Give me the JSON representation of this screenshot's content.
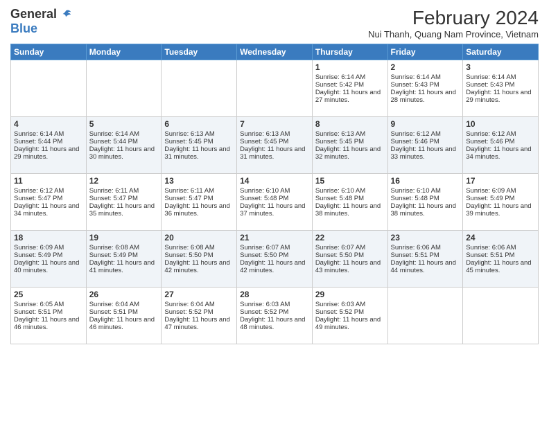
{
  "logo": {
    "general": "General",
    "blue": "Blue"
  },
  "title": {
    "month_year": "February 2024",
    "location": "Nui Thanh, Quang Nam Province, Vietnam"
  },
  "weekdays": [
    "Sunday",
    "Monday",
    "Tuesday",
    "Wednesday",
    "Thursday",
    "Friday",
    "Saturday"
  ],
  "weeks": [
    [
      {
        "day": "",
        "info": ""
      },
      {
        "day": "",
        "info": ""
      },
      {
        "day": "",
        "info": ""
      },
      {
        "day": "",
        "info": ""
      },
      {
        "day": "1",
        "info": "Sunrise: 6:14 AM\nSunset: 5:42 PM\nDaylight: 11 hours and 27 minutes."
      },
      {
        "day": "2",
        "info": "Sunrise: 6:14 AM\nSunset: 5:43 PM\nDaylight: 11 hours and 28 minutes."
      },
      {
        "day": "3",
        "info": "Sunrise: 6:14 AM\nSunset: 5:43 PM\nDaylight: 11 hours and 29 minutes."
      }
    ],
    [
      {
        "day": "4",
        "info": "Sunrise: 6:14 AM\nSunset: 5:44 PM\nDaylight: 11 hours and 29 minutes."
      },
      {
        "day": "5",
        "info": "Sunrise: 6:14 AM\nSunset: 5:44 PM\nDaylight: 11 hours and 30 minutes."
      },
      {
        "day": "6",
        "info": "Sunrise: 6:13 AM\nSunset: 5:45 PM\nDaylight: 11 hours and 31 minutes."
      },
      {
        "day": "7",
        "info": "Sunrise: 6:13 AM\nSunset: 5:45 PM\nDaylight: 11 hours and 31 minutes."
      },
      {
        "day": "8",
        "info": "Sunrise: 6:13 AM\nSunset: 5:45 PM\nDaylight: 11 hours and 32 minutes."
      },
      {
        "day": "9",
        "info": "Sunrise: 6:12 AM\nSunset: 5:46 PM\nDaylight: 11 hours and 33 minutes."
      },
      {
        "day": "10",
        "info": "Sunrise: 6:12 AM\nSunset: 5:46 PM\nDaylight: 11 hours and 34 minutes."
      }
    ],
    [
      {
        "day": "11",
        "info": "Sunrise: 6:12 AM\nSunset: 5:47 PM\nDaylight: 11 hours and 34 minutes."
      },
      {
        "day": "12",
        "info": "Sunrise: 6:11 AM\nSunset: 5:47 PM\nDaylight: 11 hours and 35 minutes."
      },
      {
        "day": "13",
        "info": "Sunrise: 6:11 AM\nSunset: 5:47 PM\nDaylight: 11 hours and 36 minutes."
      },
      {
        "day": "14",
        "info": "Sunrise: 6:10 AM\nSunset: 5:48 PM\nDaylight: 11 hours and 37 minutes."
      },
      {
        "day": "15",
        "info": "Sunrise: 6:10 AM\nSunset: 5:48 PM\nDaylight: 11 hours and 38 minutes."
      },
      {
        "day": "16",
        "info": "Sunrise: 6:10 AM\nSunset: 5:48 PM\nDaylight: 11 hours and 38 minutes."
      },
      {
        "day": "17",
        "info": "Sunrise: 6:09 AM\nSunset: 5:49 PM\nDaylight: 11 hours and 39 minutes."
      }
    ],
    [
      {
        "day": "18",
        "info": "Sunrise: 6:09 AM\nSunset: 5:49 PM\nDaylight: 11 hours and 40 minutes."
      },
      {
        "day": "19",
        "info": "Sunrise: 6:08 AM\nSunset: 5:49 PM\nDaylight: 11 hours and 41 minutes."
      },
      {
        "day": "20",
        "info": "Sunrise: 6:08 AM\nSunset: 5:50 PM\nDaylight: 11 hours and 42 minutes."
      },
      {
        "day": "21",
        "info": "Sunrise: 6:07 AM\nSunset: 5:50 PM\nDaylight: 11 hours and 42 minutes."
      },
      {
        "day": "22",
        "info": "Sunrise: 6:07 AM\nSunset: 5:50 PM\nDaylight: 11 hours and 43 minutes."
      },
      {
        "day": "23",
        "info": "Sunrise: 6:06 AM\nSunset: 5:51 PM\nDaylight: 11 hours and 44 minutes."
      },
      {
        "day": "24",
        "info": "Sunrise: 6:06 AM\nSunset: 5:51 PM\nDaylight: 11 hours and 45 minutes."
      }
    ],
    [
      {
        "day": "25",
        "info": "Sunrise: 6:05 AM\nSunset: 5:51 PM\nDaylight: 11 hours and 46 minutes."
      },
      {
        "day": "26",
        "info": "Sunrise: 6:04 AM\nSunset: 5:51 PM\nDaylight: 11 hours and 46 minutes."
      },
      {
        "day": "27",
        "info": "Sunrise: 6:04 AM\nSunset: 5:52 PM\nDaylight: 11 hours and 47 minutes."
      },
      {
        "day": "28",
        "info": "Sunrise: 6:03 AM\nSunset: 5:52 PM\nDaylight: 11 hours and 48 minutes."
      },
      {
        "day": "29",
        "info": "Sunrise: 6:03 AM\nSunset: 5:52 PM\nDaylight: 11 hours and 49 minutes."
      },
      {
        "day": "",
        "info": ""
      },
      {
        "day": "",
        "info": ""
      }
    ]
  ]
}
